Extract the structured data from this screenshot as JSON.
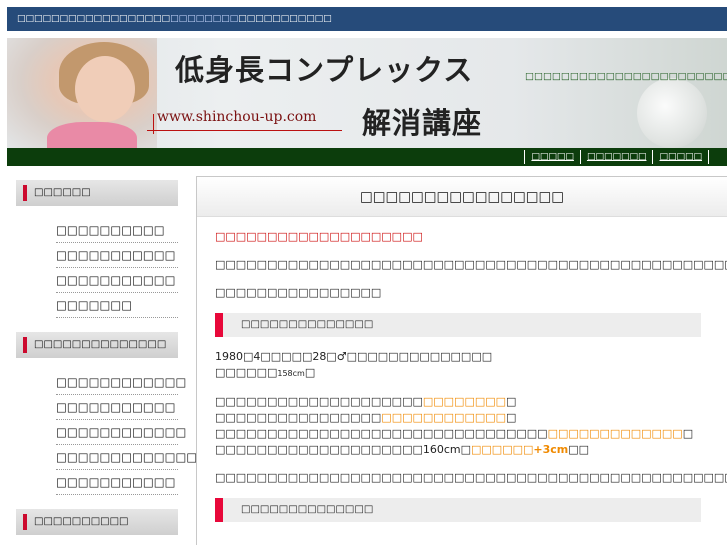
{
  "topbar": {
    "text_before": "□□□□□□□□□□□□□□□□□□",
    "link": "□□□□□□□□",
    "text_after": "□□□□□□□□□□□"
  },
  "banner": {
    "title_line1": "低身長コンプレックス",
    "title_line2": "解消講座",
    "url": "www.shinchou-up.com",
    "tagline": "□□□□□□□□□□□□□□□□□□□□□□□□□□□□□□□□□□□□□□□□□□□□"
  },
  "nav": {
    "items": [
      "□□□□□",
      "□□□□□□□",
      "□□□□□"
    ]
  },
  "sidebar": {
    "sections": [
      {
        "title": "□□□□□□",
        "items": [
          "□□□□□□□□□□",
          "□□□□□□□□□□□",
          "□□□□□□□□□□□",
          "□□□□□□□"
        ]
      },
      {
        "title": "□□□□□□□□□□□□□□",
        "items": [
          "□□□□□□□□□□□□",
          "□□□□□□□□□□□",
          "□□□□□□□□□□□□",
          "□□□□□□□□□□□□□",
          "□□□□□□□□□□□"
        ]
      },
      {
        "title": "□□□□□□□□□□",
        "items": []
      }
    ]
  },
  "main": {
    "title": "□□□□□□□□□□□□□□□□",
    "lead": "□□□□□□□□□□□□□□□□□□□□",
    "para1": "□□□□□□□□□□□□□□□□□□□□□□□□□□□□□□□□□□□□□□□□□□□□□□□□□□□□□□□□□□□□□□□□□□□□□□□□□□□□□□□□□□□□□□□□□□□□□□□",
    "para2": "□□□□□□□□□□□□□□□□",
    "subheading": "□□□□□□□□□□□□□□",
    "profile": {
      "line1": "1980□4□□□□□28□♂□□□□□□□□□□□□□□",
      "line2_text": "□□□□□□",
      "line2_small": "158cm",
      "line2_end": "□"
    },
    "list": {
      "l1_text": "□□□□□□□□□□□□□□□□□□□□",
      "l1_hl": "□□□□□□□□",
      "l1_end": "□",
      "l2_text": "□□□□□□□□□□□□□□□□",
      "l2_hl": "□□□□□□□□□□□□",
      "l2_end": "□",
      "l3_text": "□□□□□□□□□□□□□□□□□□□□□□□□□□□□□□□□",
      "l3_hl": "□□□□□□□□□□□□□",
      "l3_end": "□",
      "l4_text": "□□□□□□□□□□□□□□□□□□□□160cm□",
      "l4_hl": "□□□□□□+3cm",
      "l4_end": "□□"
    },
    "para3": "□□□□□□□□□□□□□□□□□□□□□□□□□□□□□□□□□□□□□□□□□□□□□□□□□□□□□□□□□□□□□",
    "subheading2": "□□□□□□□□□□□□□□"
  },
  "colors": {
    "topbar_bg": "#264b7a",
    "nav_bg": "#0c3d0c",
    "accent_red": "#e8083a",
    "highlight_orange": "#f08a00"
  }
}
